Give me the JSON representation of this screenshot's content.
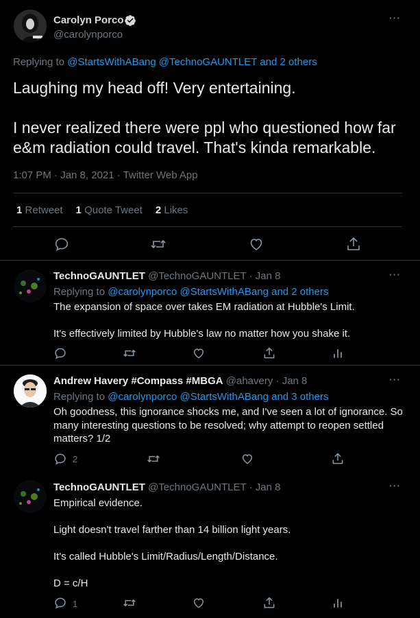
{
  "main": {
    "name": "Carolyn Porco",
    "handle": "@carolynporco",
    "replying_prefix": "Replying to ",
    "replying_links": "@StartsWithABang @TechnoGAUNTLET and 2 others",
    "text_line1": "Laughing my head off!  Very entertaining.",
    "text_line2": "I never realized there were ppl who questioned how far e&m radiation could travel.  That's kinda remarkable.",
    "meta": "1:07 PM · Jan 8, 2021 · Twitter Web App",
    "retweets_count": "1",
    "retweets_label": "Retweet",
    "quotes_count": "1",
    "quotes_label": "Quote Tweet",
    "likes_count": "2",
    "likes_label": "Likes",
    "avatar_caption": "C. PORCO"
  },
  "replies": [
    {
      "name": "TechnoGAUNTLET",
      "handle": "@TechnoGAUNTLET",
      "date": "Jan 8",
      "replying_prefix": "Replying to ",
      "replying_links": "@carolynporco @StartsWithABang and 2 others",
      "p1": "The expansion of space over takes EM radiation at Hubble's Limit.",
      "p2": "It's effectively limited by Hubble's law no matter how you shake it."
    },
    {
      "name": "Andrew Havery #Compass #MBGA",
      "handle": "@ahavery",
      "date": "Jan 8",
      "replying_prefix": "Replying to ",
      "replying_links": "@carolynporco @StartsWithABang and 3 others",
      "p1": "Oh goodness, this ignorance shocks me, and I've seen a lot of ignorance. So many interesting questions to be resolved; why attempt to reopen settled matters? 1/2",
      "reply_count": "2"
    },
    {
      "name": "TechnoGAUNTLET",
      "handle": "@TechnoGAUNTLET",
      "date": "Jan 8",
      "p1": "Empirical evidence.",
      "p2": "Light doesn't travel farther than 14 billion light years.",
      "p3": "It's called Hubble's Limit/Radius/Length/Distance.",
      "p4": "D = c/H",
      "reply_count": "1"
    }
  ],
  "separator": " · ",
  "more_label": "···"
}
